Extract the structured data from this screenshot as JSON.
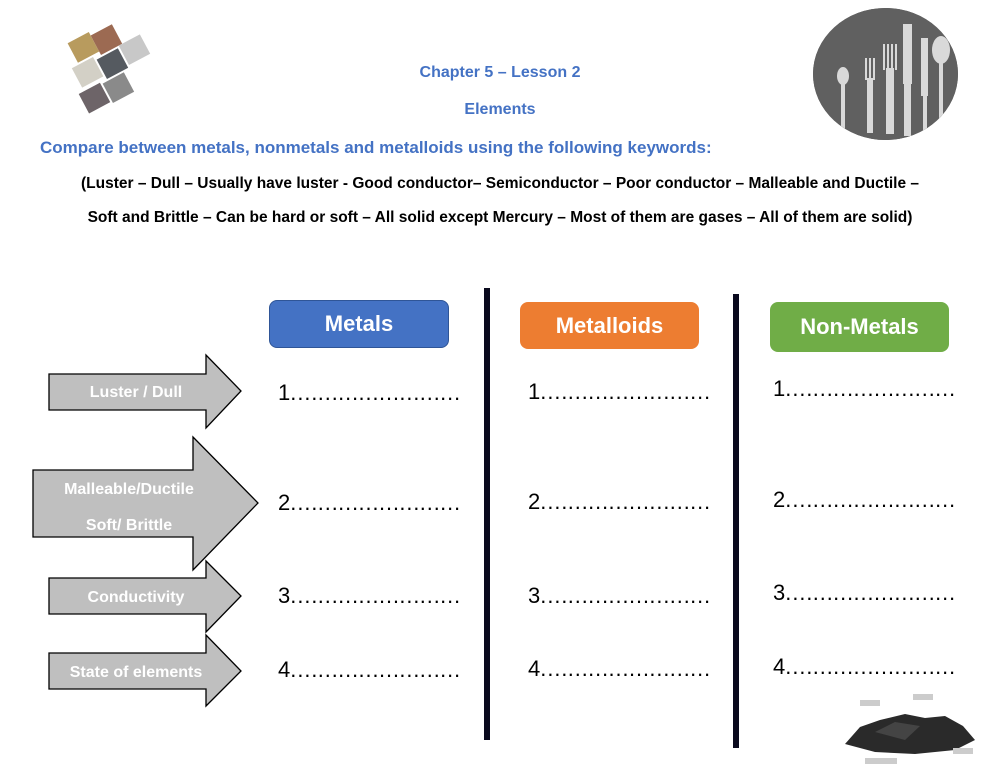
{
  "header": {
    "chapter": "Chapter 5 – Lesson 2",
    "topic": "Elements",
    "instruction": "Compare between metals, nonmetals and metalloids using the following keywords:",
    "keywords_line1": "(Luster – Dull – Usually have luster - Good conductor– Semiconductor – Poor conductor – Malleable and Ductile –",
    "keywords_line2": "Soft and Brittle – Can be hard or soft – All solid except Mercury – Most of them are gases – All of them are solid)"
  },
  "columns": [
    {
      "label": "Metals",
      "color": "#4472c4"
    },
    {
      "label": "Metalloids",
      "color": "#ed7d31"
    },
    {
      "label": "Non-Metals",
      "color": "#70ad47"
    }
  ],
  "properties": [
    {
      "line1": "Luster / Dull",
      "line2": ""
    },
    {
      "line1": "Malleable/Ductile",
      "line2": "Soft/ Brittle"
    },
    {
      "line1": "Conductivity",
      "line2": ""
    },
    {
      "line1": "State of elements",
      "line2": ""
    }
  ],
  "blanks": {
    "metals": [
      "1.",
      "2.",
      "3.",
      "4."
    ],
    "metalloids": [
      "1.",
      "2.",
      "3.",
      "4."
    ],
    "nonmetals": [
      "1.",
      "2.",
      "3.",
      "4."
    ],
    "dots": "……………………"
  },
  "images": {
    "top_left": "metal-cubes",
    "top_right": "cutlery",
    "bottom_right": "coal-pile"
  }
}
